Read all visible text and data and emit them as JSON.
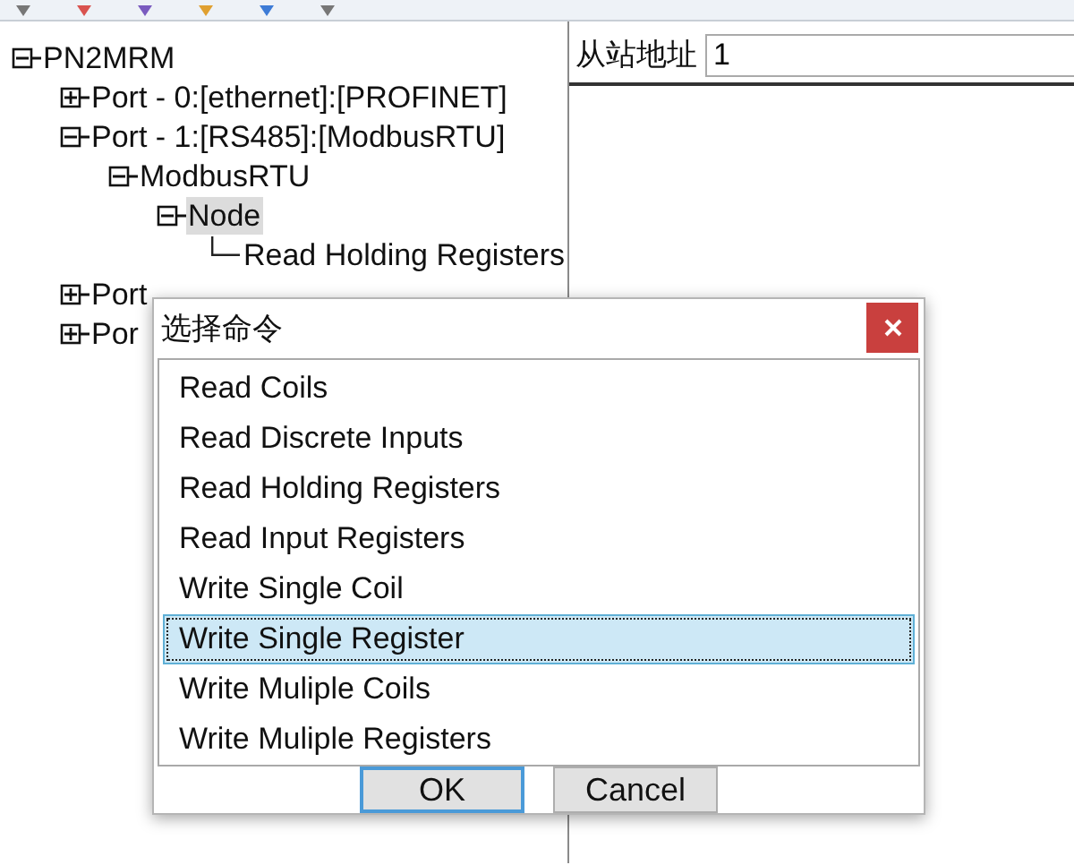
{
  "tree": {
    "label": "PN2MRM",
    "expanded": true,
    "selected": false,
    "children": [
      {
        "label": "Port - 0:[ethernet]:[PROFINET]",
        "expanded": false,
        "selected": false
      },
      {
        "label": "Port - 1:[RS485]:[ModbusRTU]",
        "expanded": true,
        "selected": false,
        "children": [
          {
            "label": "ModbusRTU",
            "expanded": true,
            "selected": false,
            "children": [
              {
                "label": "Node",
                "expanded": true,
                "selected": true,
                "children": [
                  {
                    "label": "Read Holding Registers",
                    "selected": false
                  }
                ]
              }
            ]
          }
        ]
      },
      {
        "label": "Port",
        "expanded": false,
        "selected": false
      },
      {
        "label": "Por",
        "expanded": false,
        "selected": false
      }
    ]
  },
  "slave_panel": {
    "label": "从站地址",
    "value": "1"
  },
  "dialog": {
    "title": "选择命令",
    "commands": [
      {
        "label": "Read Coils",
        "selected": false
      },
      {
        "label": "Read Discrete Inputs",
        "selected": false
      },
      {
        "label": "Read Holding Registers",
        "selected": false
      },
      {
        "label": "Read Input Registers",
        "selected": false
      },
      {
        "label": "Write Single Coil",
        "selected": false
      },
      {
        "label": "Write Single Register",
        "selected": true
      },
      {
        "label": "Write Muliple Coils",
        "selected": false
      },
      {
        "label": "Write Muliple Registers",
        "selected": false
      }
    ],
    "buttons": [
      {
        "label": "OK",
        "default": true
      },
      {
        "label": "Cancel",
        "default": false
      }
    ]
  }
}
